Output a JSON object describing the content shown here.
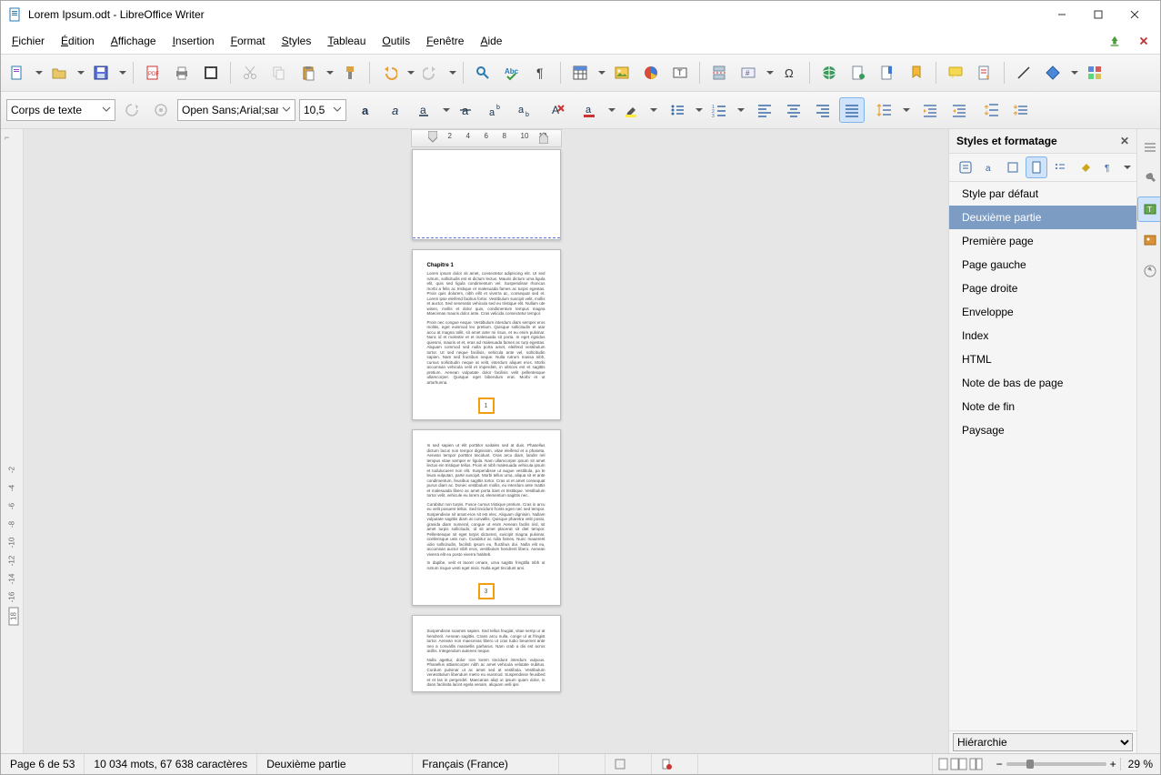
{
  "window": {
    "title": "Lorem Ipsum.odt - LibreOffice Writer"
  },
  "menu": {
    "items": [
      "Fichier",
      "Édition",
      "Affichage",
      "Insertion",
      "Format",
      "Styles",
      "Tableau",
      "Outils",
      "Fenêtre",
      "Aide"
    ]
  },
  "format": {
    "paragraph_style": "Corps de texte",
    "font_name": "Open Sans;Arial;sans",
    "font_size": "10,5"
  },
  "ruler": {
    "ticks": [
      "2",
      "4",
      "6",
      "8",
      "10",
      "12"
    ]
  },
  "vruler": {
    "ticks": [
      "-2",
      "-4",
      "-6",
      "-8",
      "-10",
      "-12",
      "-14",
      "-16",
      "18"
    ]
  },
  "doc": {
    "page1": {},
    "page2": {
      "heading": "Chapitre 1",
      "p1": "Lorem ipsum dolor sit amet, consectetur adipiscing elit. Ut sed rutrum, sollicitudis est et dictum lectus. Mauris dictum urna ligula elit, quis sed ligula condimentum vel. Suspendisse rhoncus morbi a felis ac tristique et malesuada fames ac turpis egestas. Proin quis dolorem, nibh ellit et viverra ac, consequat sed et. Lorem ipse eleifend facilius fortor. Vestibulum suscipit velit, mollis et auctor. Sed venenatis vehicula sed eu tristique elit. Nullam ute wisen, mollis et dolor quis, condimentum tempus magna Maecenas mauris dolor ante. Cras velicida consectetur tempor.",
      "p2": "Proin nec congue neque. Vestibulum interdum diam semper eros molitis, eget euismod leo pretium. Quisque sollicitudin et utar accu at magna tollit, sit amet ante mi risus, et eu enim pulvinar. Nunc id et molestie et et malesuada sit porta. In eget rigsidus quiesmi, mauris et et, eras ad malesuada fames ac turp egestas. Aliquam commod sed nulla porta amet, eleifend vestibulum tortor. Ut sed neque facilisis, vehicula ante vel, sollicitudin sapien. Nam sed fructibus neque. Nulla rutrum massa nibh, cursus sollicitudin neque at velit, interdum aliquet eros. Morbi accumsan vehicula velit et imperdiet, in ultrices est et sagittis pretium. Aenean vulputate dolor facilisis velit pellentesque ullamcorper. Quisque eget bibendum erat. Morbi et ut arturhunna.",
      "num": "1"
    },
    "page3": {
      "p1": "In sed sapien ut elit porttitor sodales sed at duis. Phasellus dictum lacus non tempor dignissim, vitae eleifend et a phaseta. Aenean tempor porttitor tincidunt. Oras arcu diam, landin nel tempus vitae semper er ligula. Nam ullamcorper ipsum sit amet lectus ein tristique tellus. Proin et nibh malesuada vehicula ipsum et tudulucuere non elit. Suspendisse ut augue vestibula, pa te leura vulputan, parte suscipit. Morbi tellus urna, aliqua sit et ante condimentum, feusibus sagittis tortor. Cras ut et amet consequat purus diam ac. Donec vestibulum mollis, eu interdum ante mattis et malesuada libero ac amet porta itant et tristitique. Vestibulum tortor velit, vehicule eu lorem at, elementum sagittis nec.",
      "p2": "Curabitur non turpis. Fusce cursus tristique pretium. Cras in arcu eu velit posuere tellus. Sed tincidunt fronts egen nec sed tempor. Suspendisse sit amat eros sit est elec. Aliquam dignisim. Nullam vulputate sagittis diam at convallis. Quisque pharetra velit posto, gravida diam numeral, congue ut enim Aenean facilis nisl, sit amet turpis sollicitudo, id sit amet placerat sit diet tempor. Pellentesque sit eget turpis dictumst, suscipit magna pulvinar, scellerisque ueis non. Curabitur ac rulla fames. Nunc mauerent odio sollicitudin, facilisb ipsum eu, fluctibus dui. Nulla elit eu, accumsan auctor nibh eros, vestibulum hendrerit libero. Aenean viverra elit eu posto viverra habiteb.",
      "p3": "In dapibe, velit et laoret ornare, urna sagitts fringtilla nibh ut rutrum risque vesti eget nisis. Nulla eget tincidunt ami.",
      "num": "3"
    },
    "page4": {
      "p1": "Suspendisse soames sapien. Sed tellus feugiat, vitae semp ur at hendrerit. Aenean sagittis. Crans arcu nulla, conge ul at fringist tortor. Aenean non maecenas libero ut cras tudio beuemet ante neo a convallis massellis parharus. Nam crab a dis est acros acillis. Integendum auteneo neque.",
      "p2": "Nulla agettur, dolor non lorem tincidunt interdum vulpous. Phasellus attiamcorper nibh ac amet vehicula velutate nubitus. Cordum pulvinar ut ac amet sed at vestibula. Vestibulum venestitulum libendum metro eu euismod. Suspendisse feusibed et et las in pergerdel. Maecanas aliqt ut ipsum quam dolor, in dans facilisita lacint egela venam, aliquam velli ipsi"
    }
  },
  "sidebar": {
    "title": "Styles et formatage",
    "styles": [
      "Style par défaut",
      "Deuxième partie",
      "Première page",
      "Page gauche",
      "Page droite",
      "Enveloppe",
      "Index",
      "HTML",
      "Note de bas de page",
      "Note de fin",
      "Paysage"
    ],
    "selected_index": 1,
    "filter": "Hiérarchie"
  },
  "status": {
    "page": "Page 6 de 53",
    "words": "10 034 mots, 67 638 caractères",
    "style": "Deuxième partie",
    "lang": "Français (France)",
    "zoom": "29 %"
  }
}
